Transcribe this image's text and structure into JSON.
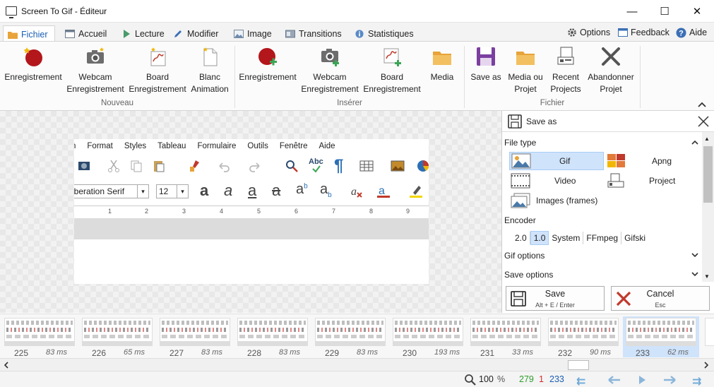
{
  "window": {
    "title": "Screen To Gif - Éditeur",
    "minimize": "—",
    "maximize": "☐",
    "close": "✕"
  },
  "tabs": [
    {
      "label": "Fichier",
      "icon": "folder-icon"
    },
    {
      "label": "Accueil",
      "icon": "window-icon"
    },
    {
      "label": "Lecture",
      "icon": "play-icon"
    },
    {
      "label": "Modifier",
      "icon": "pencil-icon"
    },
    {
      "label": "Image",
      "icon": "image-icon"
    },
    {
      "label": "Transitions",
      "icon": "transitions-icon"
    },
    {
      "label": "Statistiques",
      "icon": "info-icon"
    }
  ],
  "top_right": {
    "options": "Options",
    "feedback": "Feedback",
    "help": "Aide"
  },
  "ribbon": {
    "nouveau": {
      "label": "Nouveau",
      "buttons": [
        {
          "line1": "Enregistrement",
          "line2": ""
        },
        {
          "line1": "Webcam",
          "line2": "Enregistrement"
        },
        {
          "line1": "Board",
          "line2": "Enregistrement"
        },
        {
          "line1": "Blanc",
          "line2": "Animation"
        }
      ]
    },
    "inserer": {
      "label": "Insérer",
      "buttons": [
        {
          "line1": "Enregistrement",
          "line2": ""
        },
        {
          "line1": "Webcam",
          "line2": "Enregistrement"
        },
        {
          "line1": "Board",
          "line2": "Enregistrement"
        },
        {
          "line1": "Media",
          "line2": ""
        }
      ]
    },
    "fichier": {
      "label": "Fichier",
      "buttons": [
        {
          "line1": "Save as",
          "line2": ""
        },
        {
          "line1": "Media ou",
          "line2": "Projet"
        },
        {
          "line1": "Recent",
          "line2": "Projects"
        },
        {
          "line1": "Abandonner",
          "line2": "Projet"
        }
      ]
    }
  },
  "preview": {
    "menu": [
      "n",
      "Format",
      "Styles",
      "Tableau",
      "Formulaire",
      "Outils",
      "Fenêtre",
      "Aide"
    ],
    "font_name": "iberation Serif",
    "font_size": "12",
    "ruler_marks": [
      "1",
      "2",
      "3",
      "4",
      "5",
      "6",
      "7",
      "8",
      "9"
    ],
    "abc": "Abc",
    "pilcrow": "¶"
  },
  "save_panel": {
    "title": "Save as",
    "file_type_label": "File type",
    "types": [
      {
        "label": "Gif",
        "selected": true
      },
      {
        "label": "Apng",
        "selected": false
      },
      {
        "label": "Video",
        "selected": false
      },
      {
        "label": "Project",
        "selected": false
      },
      {
        "label": "Images (frames)",
        "selected": false
      }
    ],
    "encoder_label": "Encoder",
    "encoders": [
      {
        "label": "2.0",
        "selected": false
      },
      {
        "label": "1.0",
        "selected": true
      },
      {
        "label": "System",
        "selected": false
      },
      {
        "label": "FFmpeg",
        "selected": false
      },
      {
        "label": "Gifski",
        "selected": false
      }
    ],
    "gif_options": "Gif options",
    "save_options": "Save options",
    "save_button": {
      "label": "Save",
      "shortcut": "Alt + E / Enter"
    },
    "cancel_button": {
      "label": "Cancel",
      "shortcut": "Esc"
    }
  },
  "frames": [
    {
      "number": "225",
      "ms": "83 ms",
      "selected": false
    },
    {
      "number": "226",
      "ms": "65 ms",
      "selected": false
    },
    {
      "number": "227",
      "ms": "83 ms",
      "selected": false
    },
    {
      "number": "228",
      "ms": "83 ms",
      "selected": false
    },
    {
      "number": "229",
      "ms": "83 ms",
      "selected": false
    },
    {
      "number": "230",
      "ms": "193 ms",
      "selected": false
    },
    {
      "number": "231",
      "ms": "33 ms",
      "selected": false
    },
    {
      "number": "232",
      "ms": "90 ms",
      "selected": false
    },
    {
      "number": "233",
      "ms": "62 ms",
      "selected": true
    }
  ],
  "status": {
    "zoom": "100",
    "percent": "%",
    "total_frames": "279",
    "selected_count": "1",
    "current_frame": "233",
    "total_color": "#2e9e2e",
    "selected_color": "#d12b2b",
    "current_color": "#1a5fb4"
  }
}
